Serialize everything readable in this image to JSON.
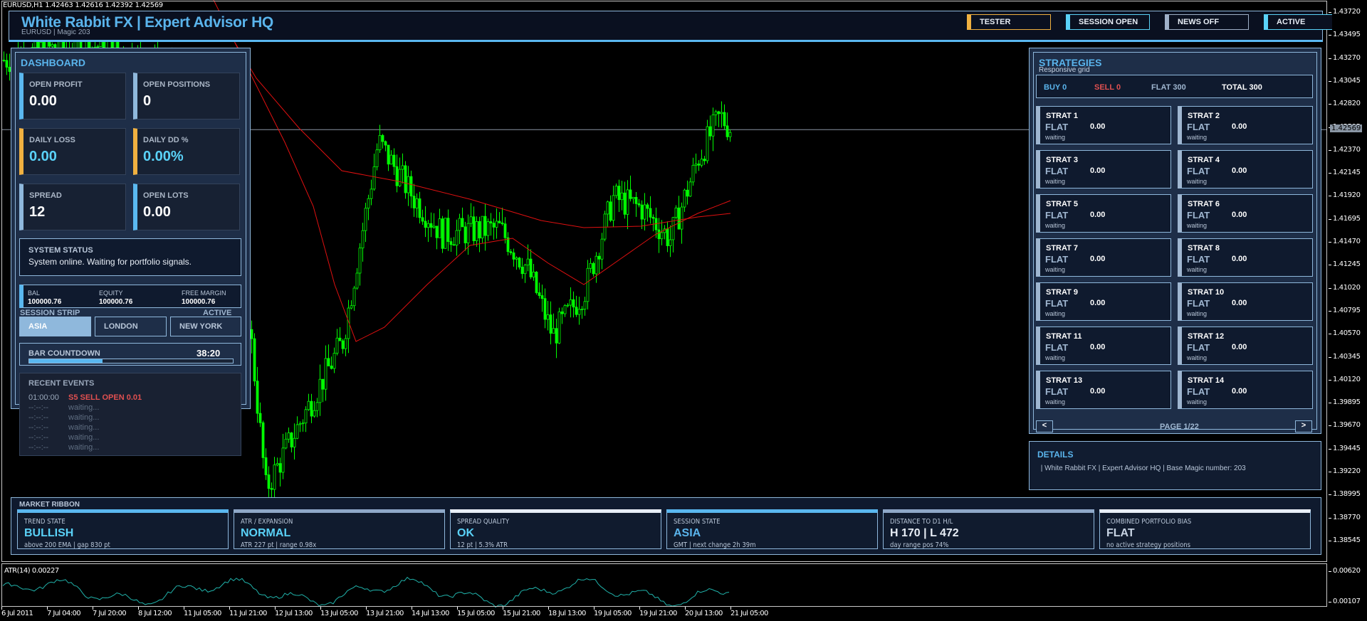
{
  "chart": {
    "ticker": "EURUSD,H1  1.42463 1.42616 1.42392 1.42569",
    "current_price": "1.42569",
    "price_axis": [
      "1.43720",
      "1.43495",
      "1.43270",
      "1.43045",
      "1.42820",
      "1.42595",
      "1.42370",
      "1.42145",
      "1.41920",
      "1.41695",
      "1.41470",
      "1.41245",
      "1.41020",
      "1.40795",
      "1.40570",
      "1.40345",
      "1.40120",
      "1.39895",
      "1.39670",
      "1.39445",
      "1.39220",
      "1.38995",
      "1.38770",
      "1.38545"
    ],
    "time_axis": [
      "6 Jul 2011",
      "7 Jul 04:00",
      "7 Jul 20:00",
      "8 Jul 12:00",
      "11 Jul 05:00",
      "11 Jul 21:00",
      "12 Jul 13:00",
      "13 Jul 05:00",
      "13 Jul 21:00",
      "14 Jul 13:00",
      "15 Jul 05:00",
      "15 Jul 21:00",
      "18 Jul 13:00",
      "19 Jul 05:00",
      "19 Jul 21:00",
      "20 Jul 13:00",
      "21 Jul 05:00"
    ],
    "atr_label": "ATR(14) 0.00227",
    "atr_axis": [
      "0.00620",
      "0.00107"
    ],
    "colors": {
      "bull": "#00ff00",
      "ma": "#e01010",
      "atr": "#20b2aa"
    }
  },
  "header": {
    "title": "White Rabbit FX | Expert Advisor HQ",
    "subtitle": "EURUSD  |  Magic 203",
    "badges": [
      {
        "label": "TESTER",
        "color": "#f0b040"
      },
      {
        "label": "SESSION OPEN",
        "color": "#5ad2f8"
      },
      {
        "label": "NEWS OFF",
        "color": "#9fb0c8"
      },
      {
        "label": "ACTIVE",
        "color": "#5ad2f8"
      }
    ]
  },
  "dashboard": {
    "title": "DASHBOARD",
    "cards": [
      {
        "label": "OPEN PROFIT",
        "value": "0.00",
        "color": "#5ab8f0",
        "vcolor": "#ffffff"
      },
      {
        "label": "OPEN POSITIONS",
        "value": "0",
        "color": "#8fb8dc",
        "vcolor": "#ffffff"
      },
      {
        "label": "DAILY LOSS",
        "value": "0.00",
        "color": "#f0b040",
        "vcolor": "#5ad2f8"
      },
      {
        "label": "DAILY DD %",
        "value": "0.00%",
        "color": "#f0b040",
        "vcolor": "#5ad2f8"
      },
      {
        "label": "SPREAD",
        "value": "12",
        "color": "#8fb8dc",
        "vcolor": "#ffffff"
      },
      {
        "label": "OPEN LOTS",
        "value": "0.00",
        "color": "#5ab8f0",
        "vcolor": "#ffffff"
      }
    ],
    "status_title": "SYSTEM STATUS",
    "status_text": "System online. Waiting for portfolio signals.",
    "bal_label": "BAL",
    "bal": "100000.76",
    "equity_label": "EQUITY",
    "equity": "100000.76",
    "margin_label": "FREE MARGIN",
    "margin": "100000.76",
    "session_label": "SESSION STRIP",
    "session_state": "ACTIVE",
    "sessions": [
      "ASIA",
      "LONDON",
      "NEW YORK"
    ],
    "countdown_label": "BAR COUNTDOWN",
    "countdown": "38:20",
    "countdown_progress": 0.36,
    "events_title": "RECENT EVENTS",
    "events": [
      {
        "time": "01:00:00",
        "text": "S5 SELL OPEN 0.01"
      },
      {
        "time": "--:--:--",
        "text": "waiting..."
      },
      {
        "time": "--:--:--",
        "text": "waiting..."
      },
      {
        "time": "--:--:--",
        "text": "waiting..."
      },
      {
        "time": "--:--:--",
        "text": "waiting..."
      },
      {
        "time": "--:--:--",
        "text": "waiting..."
      }
    ]
  },
  "strategies": {
    "title": "STRATEGIES",
    "subtitle": "Responsive grid",
    "buy": "BUY 0",
    "sell": "SELL 0",
    "flat": "FLAT 300",
    "total": "TOTAL 300",
    "items": [
      {
        "name": "STRAT 1",
        "state": "FLAT",
        "pnl": "0.00",
        "note": "waiting"
      },
      {
        "name": "STRAT 2",
        "state": "FLAT",
        "pnl": "0.00",
        "note": "waiting"
      },
      {
        "name": "STRAT 3",
        "state": "FLAT",
        "pnl": "0.00",
        "note": "waiting"
      },
      {
        "name": "STRAT 4",
        "state": "FLAT",
        "pnl": "0.00",
        "note": "waiting"
      },
      {
        "name": "STRAT 5",
        "state": "FLAT",
        "pnl": "0.00",
        "note": "waiting"
      },
      {
        "name": "STRAT 6",
        "state": "FLAT",
        "pnl": "0.00",
        "note": "waiting"
      },
      {
        "name": "STRAT 7",
        "state": "FLAT",
        "pnl": "0.00",
        "note": "waiting"
      },
      {
        "name": "STRAT 8",
        "state": "FLAT",
        "pnl": "0.00",
        "note": "waiting"
      },
      {
        "name": "STRAT 9",
        "state": "FLAT",
        "pnl": "0.00",
        "note": "waiting"
      },
      {
        "name": "STRAT 10",
        "state": "FLAT",
        "pnl": "0.00",
        "note": "waiting"
      },
      {
        "name": "STRAT 11",
        "state": "FLAT",
        "pnl": "0.00",
        "note": "waiting"
      },
      {
        "name": "STRAT 12",
        "state": "FLAT",
        "pnl": "0.00",
        "note": "waiting"
      },
      {
        "name": "STRAT 13",
        "state": "FLAT",
        "pnl": "0.00",
        "note": "waiting"
      },
      {
        "name": "STRAT 14",
        "state": "FLAT",
        "pnl": "0.00",
        "note": "waiting"
      }
    ],
    "prev": "<",
    "next": ">",
    "page": "PAGE 1/22"
  },
  "details": {
    "title": "DETAILS",
    "text": " | White Rabbit FX | Expert Advisor HQ | Base Magic number: 203"
  },
  "ribbon": {
    "title": "MARKET RIBBON",
    "cards": [
      {
        "label": "TREND STATE",
        "value": "BULLISH",
        "sub": "above 200 EMA | gap 830 pt",
        "color": "#5ab8f0",
        "vcolor": "#5ad2f8"
      },
      {
        "label": "ATR / EXPANSION",
        "value": "NORMAL",
        "sub": "ATR 227 pt | range 0.98x",
        "color": "#8fa8c8",
        "vcolor": "#5ad2f8"
      },
      {
        "label": "SPREAD QUALITY",
        "value": "OK",
        "sub": "12 pt | 5.3% ATR",
        "color": "#e8eef6",
        "vcolor": "#5ad2f8"
      },
      {
        "label": "SESSION STATE",
        "value": "ASIA",
        "sub": "GMT | next change 2h 39m",
        "color": "#5ab8f0",
        "vcolor": "#5ab4ec"
      },
      {
        "label": "DISTANCE TO D1 H/L",
        "value": "H 170 | L 472",
        "sub": "day range pos 74%",
        "color": "#8fa8c8",
        "vcolor": "#e8eef6"
      },
      {
        "label": "COMBINED PORTFOLIO BIAS",
        "value": "FLAT",
        "sub": "no active strategy positions",
        "color": "#e8eef6",
        "vcolor": "#c8d4e4"
      }
    ]
  }
}
